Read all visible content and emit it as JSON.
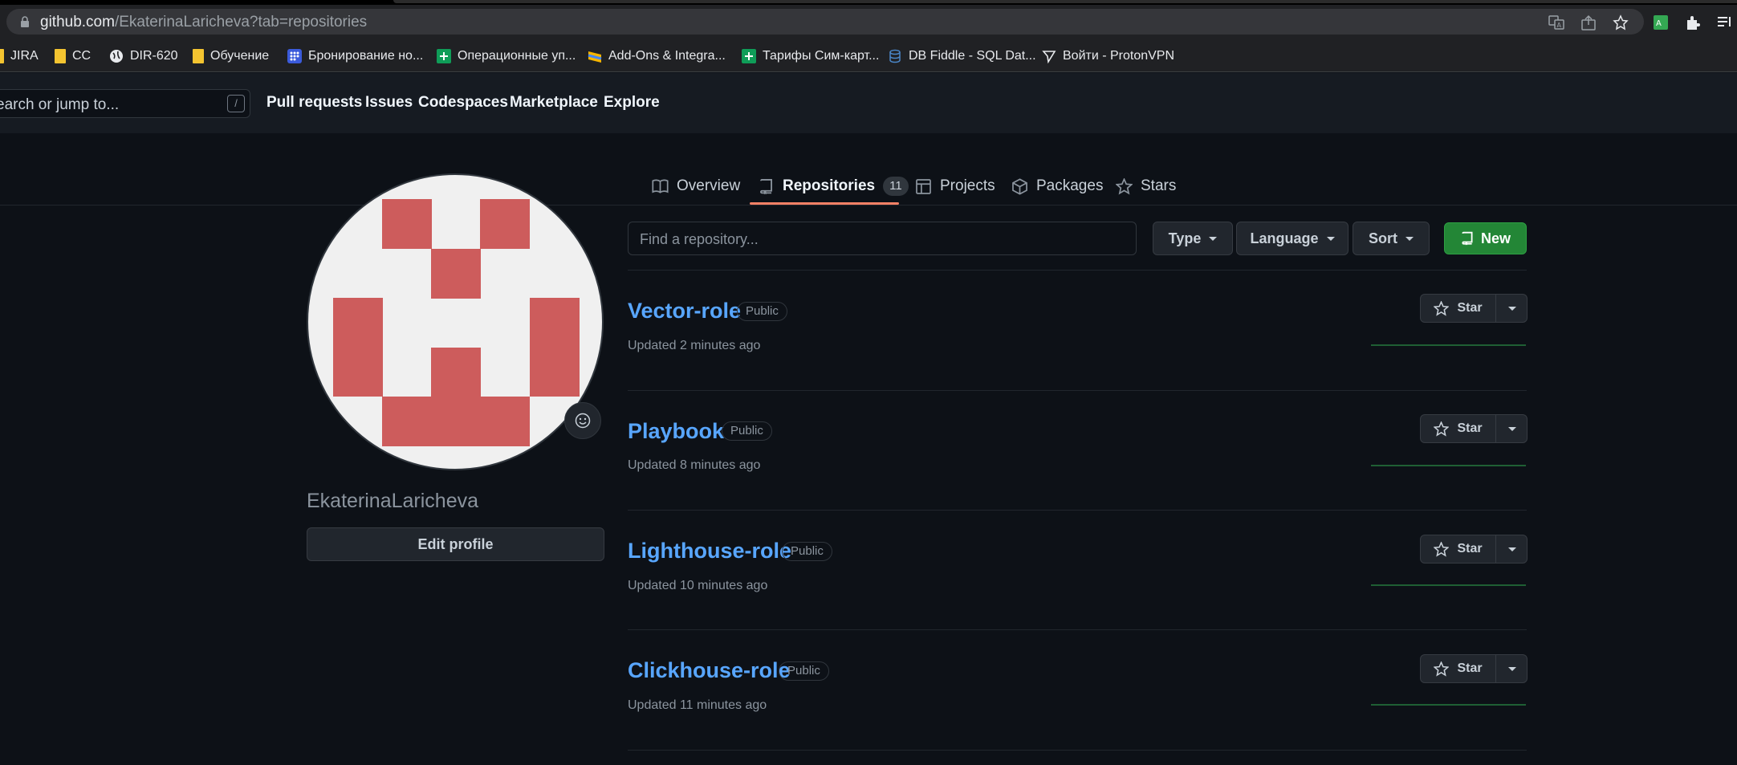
{
  "browser": {
    "url_host": "github.com",
    "url_path": "/EkaterinaLaricheva?tab=repositories",
    "bookmarks": [
      {
        "label": "JIRA",
        "icon": "folder-icon"
      },
      {
        "label": "CC",
        "icon": "folder-icon"
      },
      {
        "label": "DIR-620",
        "icon": "globe-icon"
      },
      {
        "label": "Обучение",
        "icon": "folder-icon"
      },
      {
        "label": "Бронирование но...",
        "icon": "grid-app-icon"
      },
      {
        "label": "Операционные уп...",
        "icon": "sheets-icon"
      },
      {
        "label": "Add-Ons & Integra...",
        "icon": "addon-icon"
      },
      {
        "label": "Тарифы Сим-карт...",
        "icon": "sheets-icon"
      },
      {
        "label": "DB Fiddle - SQL Dat...",
        "icon": "database-icon"
      },
      {
        "label": "Войти - ProtonVPN",
        "icon": "proton-icon"
      }
    ]
  },
  "header": {
    "search_placeholder": "earch or jump to...",
    "search_shortcut": "/",
    "nav": [
      "Pull requests",
      "Issues",
      "Codespaces",
      "Marketplace",
      "Explore"
    ]
  },
  "tabs": [
    {
      "label": "Overview",
      "icon": "book-icon"
    },
    {
      "label": "Repositories",
      "icon": "repo-icon",
      "count": "11",
      "selected": true
    },
    {
      "label": "Projects",
      "icon": "table-icon"
    },
    {
      "label": "Packages",
      "icon": "package-icon"
    },
    {
      "label": "Stars",
      "icon": "star-icon"
    }
  ],
  "profile": {
    "username": "EkaterinaLaricheva",
    "edit_label": "Edit profile",
    "avatar_color": "#cd5c5c"
  },
  "filters": {
    "find_placeholder": "Find a repository...",
    "type_label": "Type",
    "language_label": "Language",
    "sort_label": "Sort",
    "new_label": "New"
  },
  "repos": [
    {
      "name": "Vector-role",
      "visibility": "Public",
      "updated": "Updated 2 minutes ago",
      "star_label": "Star"
    },
    {
      "name": "Playbook",
      "visibility": "Public",
      "updated": "Updated 8 minutes ago",
      "star_label": "Star"
    },
    {
      "name": "Lighthouse-role",
      "visibility": "Public",
      "updated": "Updated 10 minutes ago",
      "star_label": "Star"
    },
    {
      "name": "Clickhouse-role",
      "visibility": "Public",
      "updated": "Updated 11 minutes ago",
      "star_label": "Star"
    }
  ]
}
